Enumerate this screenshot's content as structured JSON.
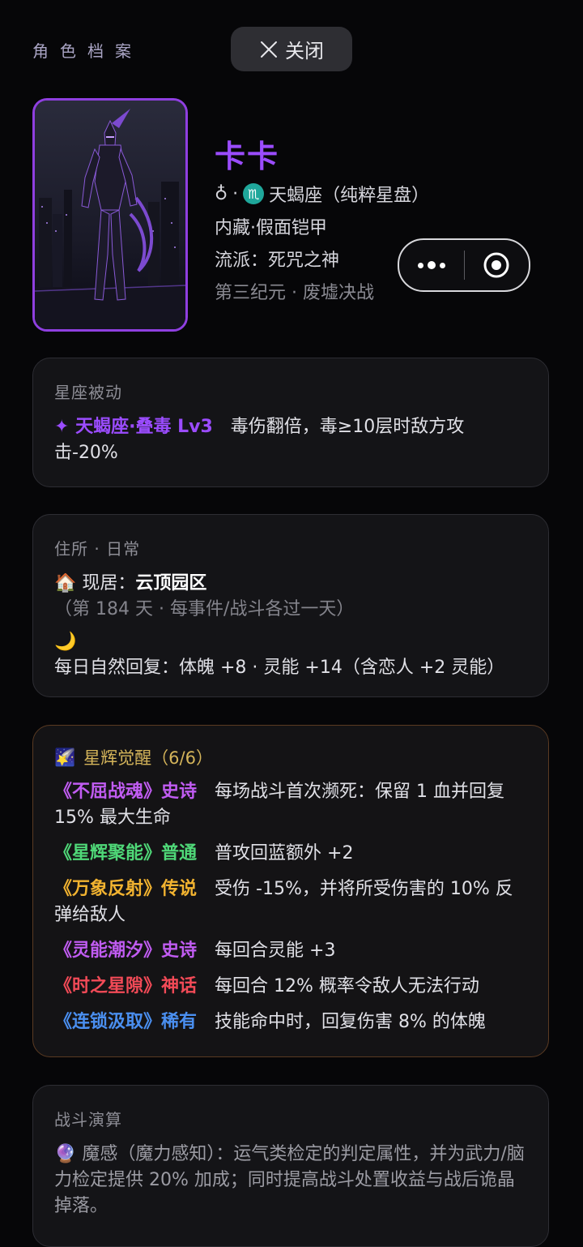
{
  "header": {
    "title": "角色档案",
    "close_label": "关闭"
  },
  "profile": {
    "name": "卡卡",
    "gender_symbol": "♁",
    "separator": "·",
    "zodiac_symbol": "♏",
    "zodiac_text": "天蝎座（纯粹星盘）",
    "hidden_trait": "内藏·假面铠甲",
    "school": "流派：死咒之神",
    "era": "第三纪元 · 废墟决战"
  },
  "passive": {
    "title": "星座被动",
    "name": "✦ 天蝎座·叠毒 Lv3",
    "desc": "毒伤翻倍，毒≥10层时敌方攻击-20%"
  },
  "residence": {
    "title": "住所 · 日常",
    "home_icon": "🏠",
    "home_label": "现居：",
    "home_value": "云顶园区",
    "home_note": "（第 184 天 · 每事件/战斗各过一天）",
    "moon_icon": "🌙",
    "recovery": "每日自然回复：体魄 +8 · 灵能 +14（含恋人 +2 灵能）"
  },
  "awakening": {
    "icon": "🌠",
    "title": "星辉觉醒（6/6）",
    "items": [
      {
        "name": "《不屈战魂》史诗",
        "desc": "每场战斗首次濒死：保留 1 血并回复 15% 最大生命"
      },
      {
        "name": "《星辉聚能》普通",
        "desc": "普攻回蓝额外 +2"
      },
      {
        "name": "《万象反射》传说",
        "desc": "受伤 -15%，并将所受伤害的 10% 反弹给敌人"
      },
      {
        "name": "《灵能潮汐》史诗",
        "desc": "每回合灵能 +3"
      },
      {
        "name": "《时之星隙》神话",
        "desc": "每回合 12% 概率令敌人无法行动"
      },
      {
        "name": "《连锁汲取》稀有",
        "desc": "技能命中时，回复伤害 8% 的体魄"
      }
    ]
  },
  "battle": {
    "title": "战斗演算",
    "icon": "🔮",
    "text": "魔感（魔力感知）：运气类检定的判定属性，并为武力/脑力检定提供 20% 加成；同时提高战斗处置收益与战后诡晶掉落。"
  },
  "colors": {
    "accent": "#9b4cff",
    "epic": "#c15cf2",
    "normal": "#4fd878",
    "legend": "#f2b330",
    "myth": "#f24a57",
    "rare": "#4a8ff0"
  }
}
